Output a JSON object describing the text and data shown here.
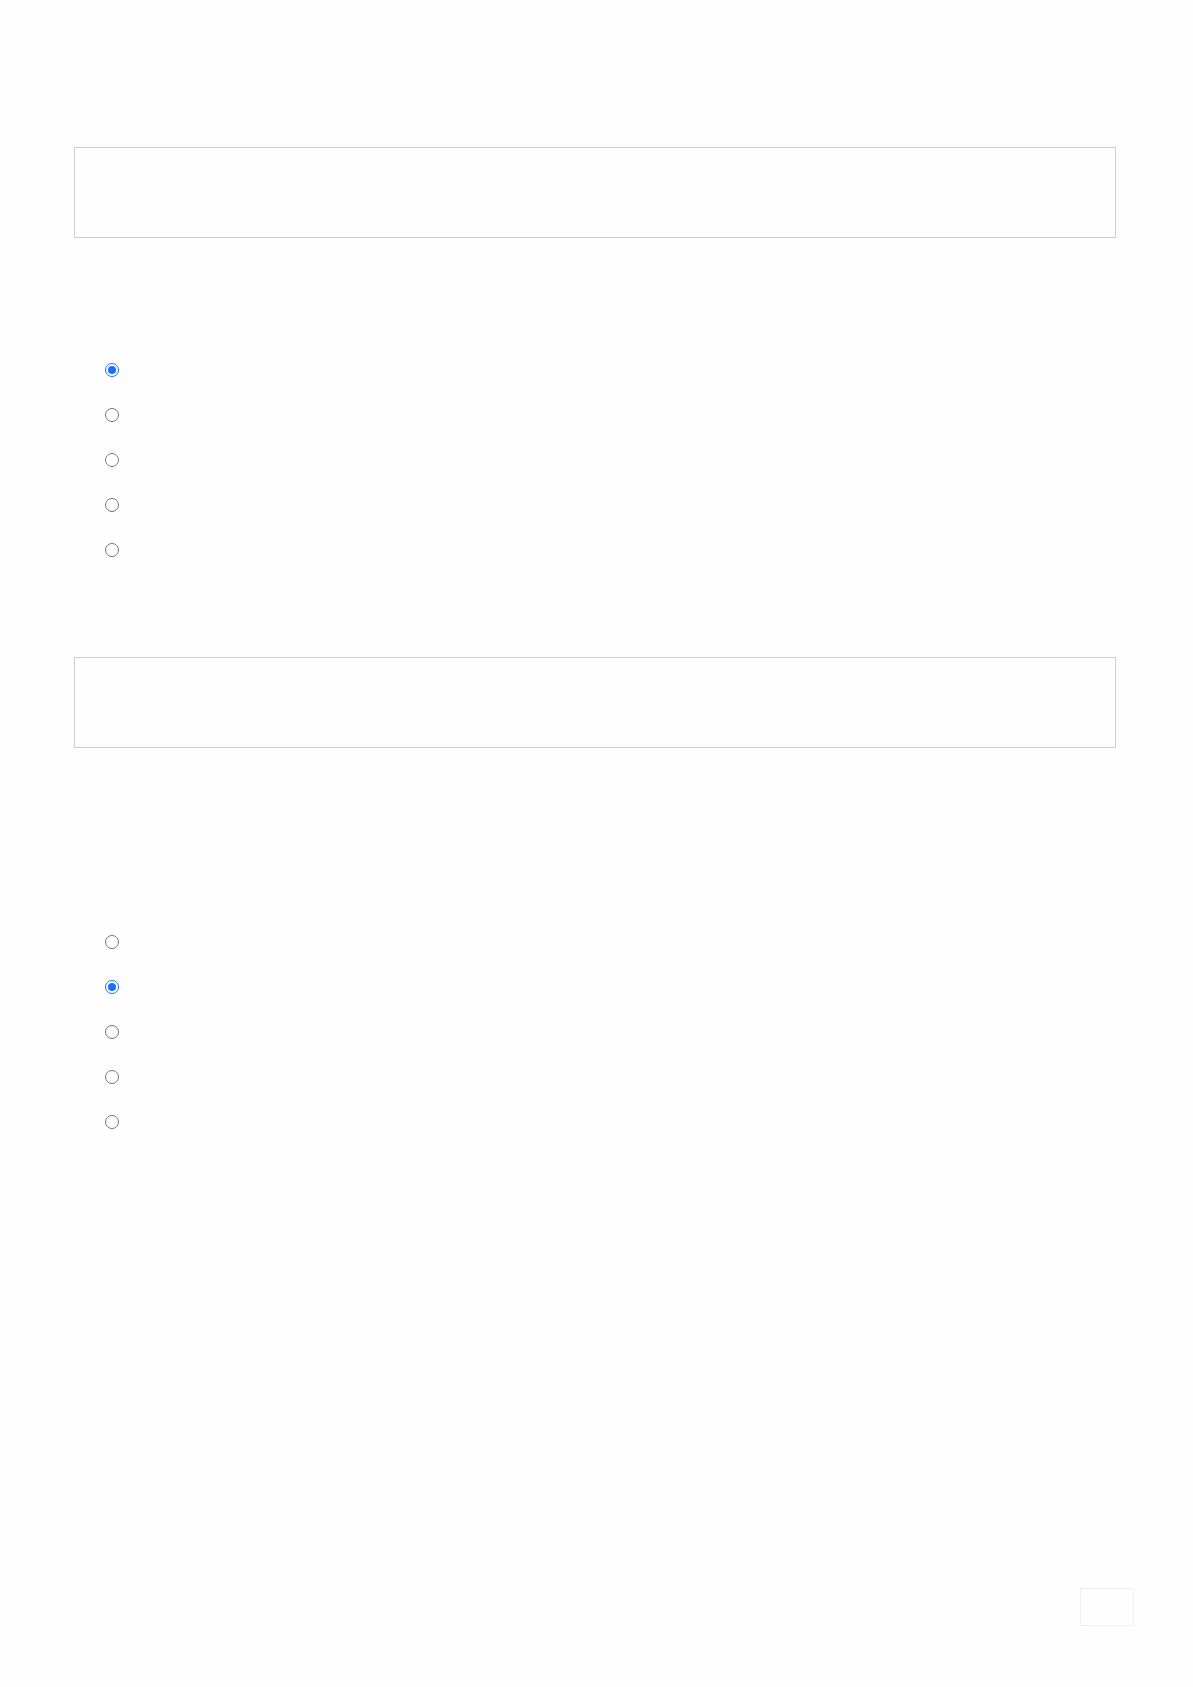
{
  "blocks": [
    {
      "kind": "textarea"
    },
    {
      "kind": "radio_group",
      "options": [
        {
          "selected": true
        },
        {
          "selected": false
        },
        {
          "selected": false
        },
        {
          "selected": false
        },
        {
          "selected": false
        }
      ]
    },
    {
      "kind": "textarea"
    },
    {
      "kind": "radio_group",
      "options": [
        {
          "selected": false
        },
        {
          "selected": true
        },
        {
          "selected": false
        },
        {
          "selected": false
        },
        {
          "selected": false
        }
      ]
    }
  ]
}
